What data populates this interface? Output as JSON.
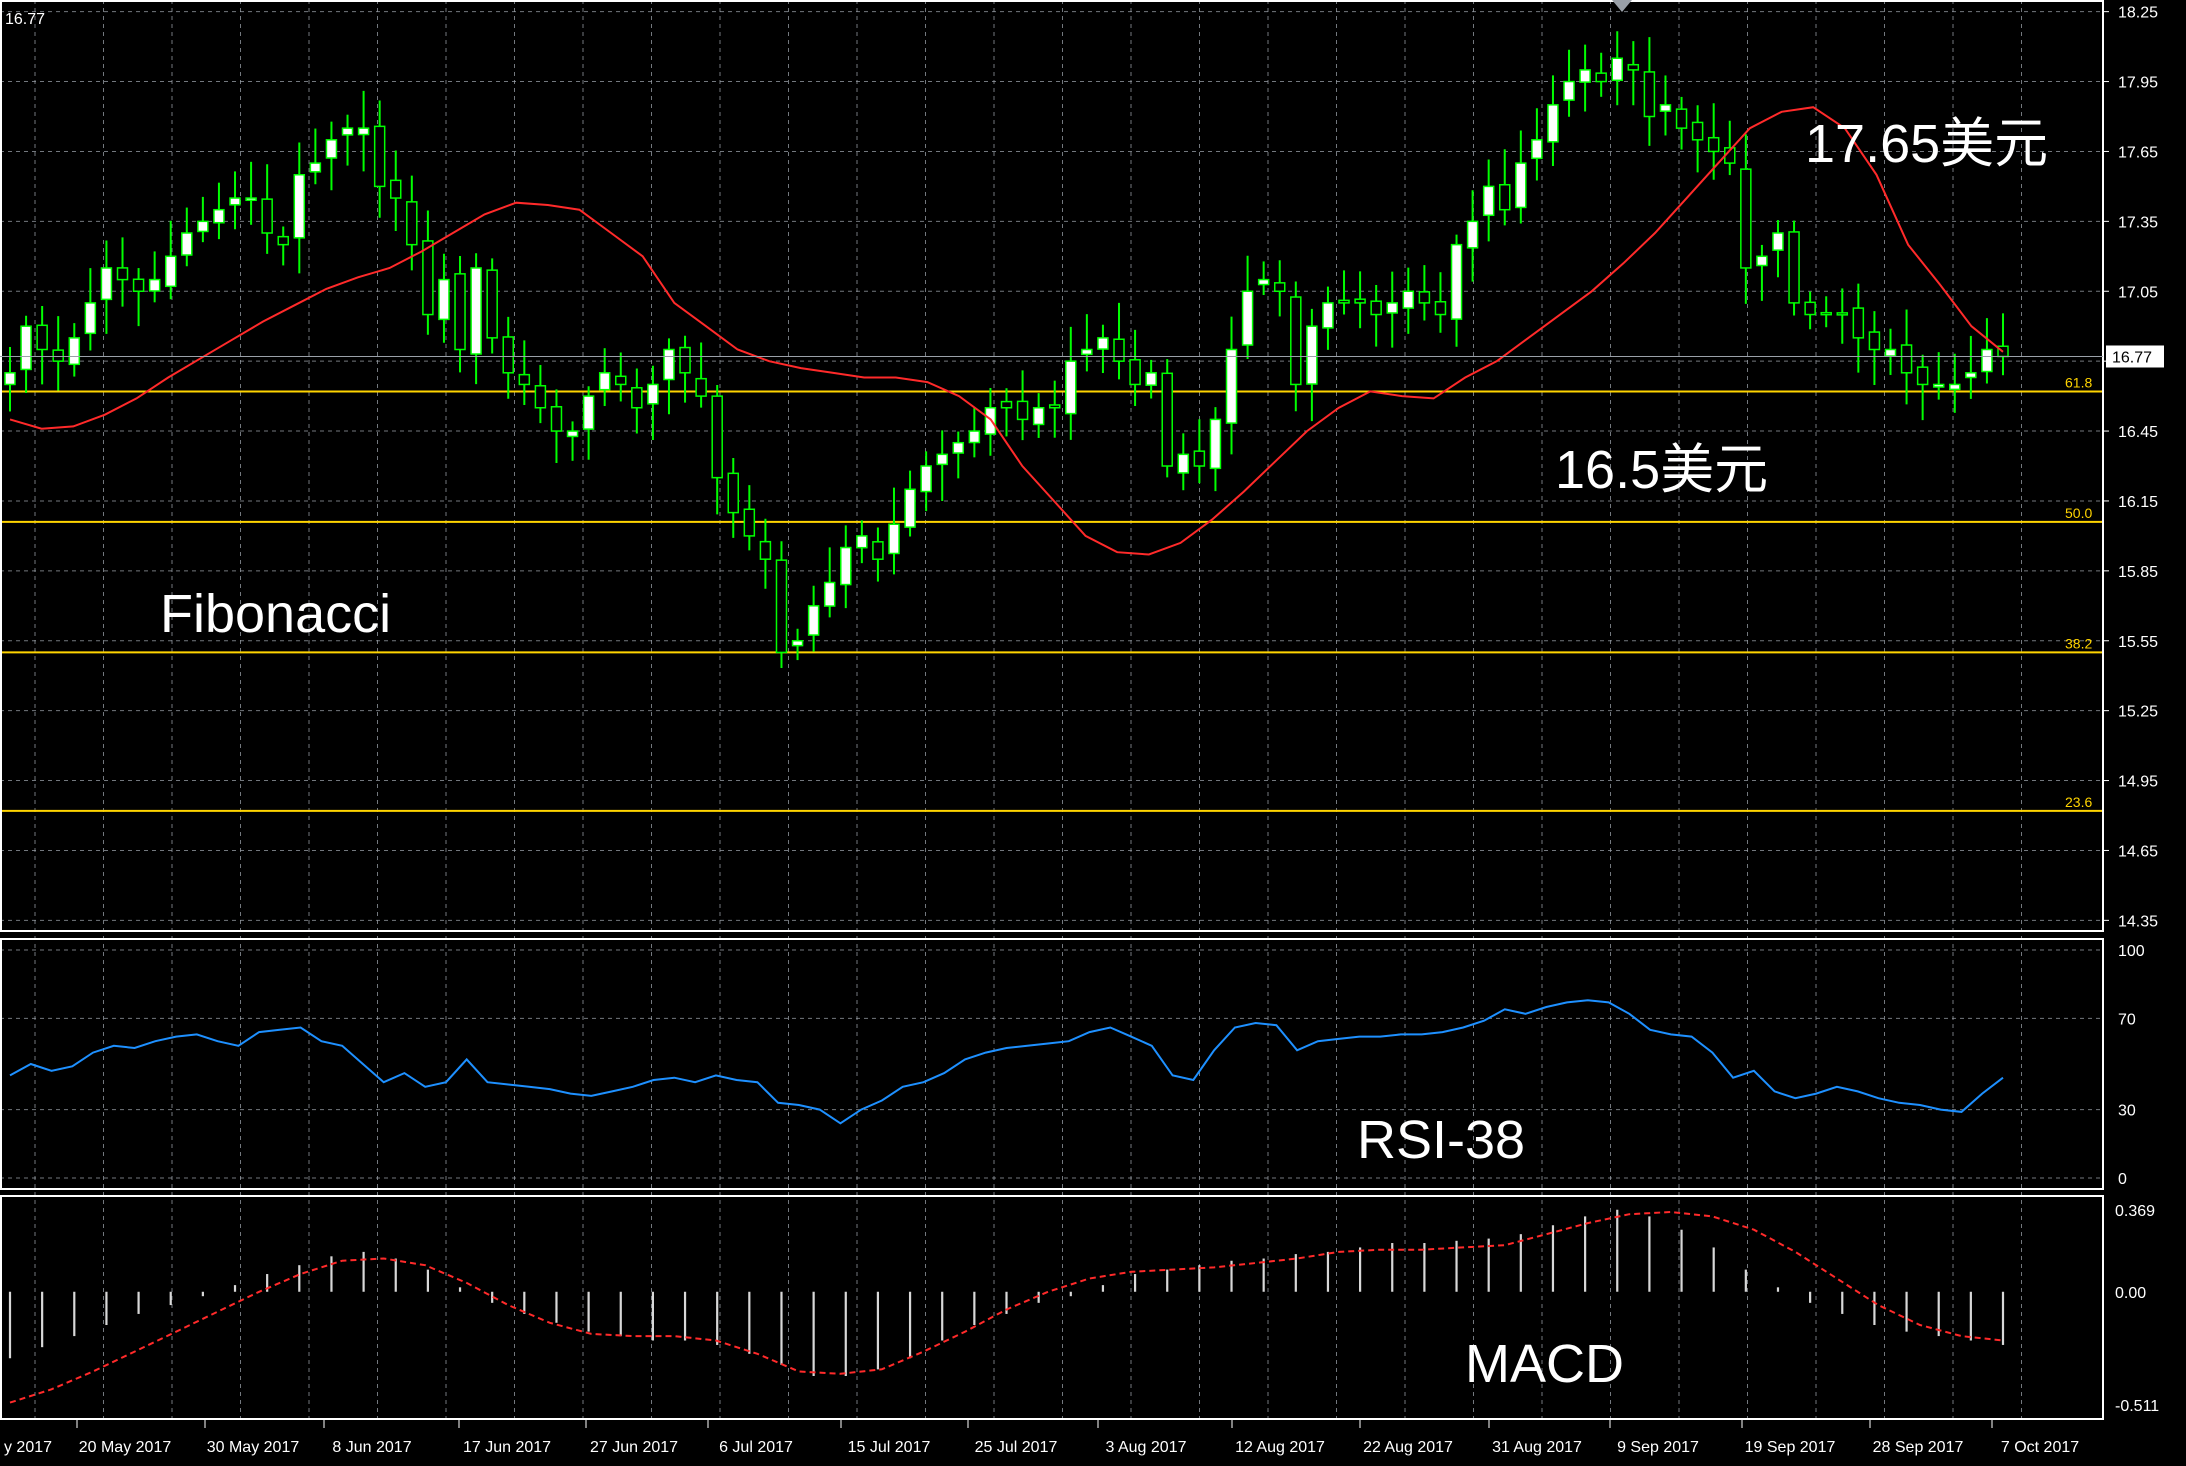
{
  "chart_data": {
    "type": "candlestick",
    "symbol_price_readout": "16.77",
    "colors": {
      "background": "#000000",
      "grid": "#9aa0a8",
      "bull_body": "#ffffff",
      "bear_body": "#000000",
      "wick": "#00ff00",
      "moving_average": "#ff2a2a",
      "fibonacci": "#ffd400",
      "rsi": "#1e90ff",
      "macd_histogram": "#d8d8d8",
      "macd_signal": "#ff2a2a"
    },
    "price_axis": {
      "ticks": [
        "18.25",
        "17.95",
        "17.65",
        "17.35",
        "17.05",
        "16.75",
        "16.45",
        "16.15",
        "15.85",
        "15.55",
        "15.25",
        "14.95",
        "14.65",
        "14.35"
      ],
      "ylim": [
        14.3,
        18.3
      ],
      "current_price": "16.77"
    },
    "fibonacci_levels": [
      {
        "label": "61.8",
        "price": 16.62
      },
      {
        "label": "50.0",
        "price": 16.06
      },
      {
        "label": "38.2",
        "price": 15.5
      },
      {
        "label": "23.6",
        "price": 14.82
      }
    ],
    "x_axis_labels": [
      "y 2017",
      "20 May 2017",
      "30 May 2017",
      "8 Jun 2017",
      "17 Jun 2017",
      "27 Jun 2017",
      "6 Jul 2017",
      "15 Jul 2017",
      "25 Jul 2017",
      "3 Aug 2017",
      "12 Aug 2017",
      "22 Aug 2017",
      "31 Aug 2017",
      "9 Sep 2017",
      "19 Sep 2017",
      "28 Sep 2017",
      "7 Oct 2017"
    ],
    "close_series": [
      16.7,
      16.9,
      16.8,
      16.75,
      16.85,
      17.0,
      17.15,
      17.1,
      17.05,
      17.1,
      17.2,
      17.3,
      17.35,
      17.4,
      17.45,
      17.45,
      17.3,
      17.25,
      17.55,
      17.6,
      17.7,
      17.75,
      17.75,
      17.5,
      17.45,
      17.25,
      16.95,
      17.1,
      16.8,
      17.15,
      16.85,
      16.7,
      16.65,
      16.55,
      16.45,
      16.45,
      16.6,
      16.7,
      16.65,
      16.55,
      16.65,
      16.8,
      16.7,
      16.6,
      16.25,
      16.1,
      16.0,
      15.9,
      15.5,
      15.55,
      15.7,
      15.8,
      15.95,
      16.0,
      15.9,
      16.05,
      16.2,
      16.3,
      16.35,
      16.4,
      16.45,
      16.55,
      16.55,
      16.5,
      16.55,
      16.55,
      16.75,
      16.8,
      16.85,
      16.75,
      16.65,
      16.7,
      16.3,
      16.35,
      16.3,
      16.5,
      16.8,
      17.05,
      17.1,
      17.05,
      16.65,
      16.9,
      17.0,
      17.0,
      17.0,
      16.95,
      17.0,
      17.05,
      17.0,
      16.95,
      17.25,
      17.35,
      17.5,
      17.4,
      17.6,
      17.7,
      17.85,
      17.95,
      18.0,
      17.95,
      18.05,
      18.0,
      17.8,
      17.85,
      17.75,
      17.7,
      17.65,
      17.6,
      17.15,
      17.2,
      17.3,
      17.0,
      16.95,
      16.95,
      16.95,
      16.85,
      16.8,
      16.8,
      16.7,
      16.65,
      16.65,
      16.65,
      16.7,
      16.8,
      16.77
    ],
    "moving_average_series": [
      16.5,
      16.46,
      16.47,
      16.52,
      16.59,
      16.68,
      16.76,
      16.84,
      16.92,
      16.99,
      17.06,
      17.11,
      17.15,
      17.22,
      17.3,
      17.38,
      17.43,
      17.42,
      17.4,
      17.3,
      17.2,
      17.0,
      16.9,
      16.8,
      16.75,
      16.72,
      16.7,
      16.68,
      16.68,
      16.66,
      16.6,
      16.5,
      16.3,
      16.15,
      16.0,
      15.93,
      15.92,
      15.97,
      16.07,
      16.19,
      16.32,
      16.45,
      16.55,
      16.62,
      16.6,
      16.59,
      16.68,
      16.75,
      16.85,
      16.95,
      17.05,
      17.17,
      17.3,
      17.45,
      17.6,
      17.75,
      17.82,
      17.84,
      17.75,
      17.55,
      17.25,
      17.08,
      16.9,
      16.79
    ],
    "rsi": {
      "label": "RSI-38",
      "ticks": [
        "100",
        "70",
        "30",
        "0"
      ],
      "values": [
        45,
        50,
        47,
        49,
        55,
        58,
        57,
        60,
        62,
        63,
        60,
        58,
        64,
        65,
        66,
        60,
        58,
        50,
        42,
        46,
        40,
        42,
        52,
        42,
        41,
        40,
        39,
        37,
        36,
        38,
        40,
        43,
        44,
        42,
        45,
        43,
        42,
        33,
        32,
        30,
        24,
        30,
        34,
        40,
        42,
        46,
        52,
        55,
        57,
        58,
        59,
        60,
        64,
        66,
        62,
        58,
        45,
        43,
        56,
        66,
        68,
        67,
        56,
        60,
        61,
        62,
        62,
        63,
        63,
        64,
        66,
        69,
        74,
        72,
        75,
        77,
        78,
        77,
        72,
        65,
        63,
        62,
        55,
        44,
        47,
        38,
        35,
        37,
        40,
        38,
        35,
        33,
        32,
        30,
        29,
        37,
        44
      ]
    },
    "macd": {
      "label": "MACD",
      "ticks": [
        "0.369",
        "0.00",
        "-0.511"
      ],
      "histogram": [
        -0.3,
        -0.25,
        -0.2,
        -0.15,
        -0.1,
        -0.06,
        -0.02,
        0.03,
        0.08,
        0.12,
        0.16,
        0.18,
        0.15,
        0.1,
        0.02,
        -0.05,
        -0.1,
        -0.14,
        -0.18,
        -0.2,
        -0.22,
        -0.22,
        -0.24,
        -0.28,
        -0.33,
        -0.38,
        -0.38,
        -0.35,
        -0.3,
        -0.22,
        -0.15,
        -0.1,
        -0.05,
        -0.02,
        0.03,
        0.08,
        0.1,
        0.12,
        0.14,
        0.15,
        0.17,
        0.18,
        0.2,
        0.22,
        0.22,
        0.23,
        0.24,
        0.26,
        0.3,
        0.34,
        0.37,
        0.34,
        0.28,
        0.2,
        0.1,
        0.02,
        -0.05,
        -0.1,
        -0.15,
        -0.18,
        -0.2,
        -0.22,
        -0.24
      ],
      "signal": [
        -0.5,
        -0.44,
        -0.36,
        -0.27,
        -0.18,
        -0.09,
        0.0,
        0.08,
        0.14,
        0.15,
        0.12,
        0.04,
        -0.06,
        -0.14,
        -0.19,
        -0.2,
        -0.2,
        -0.22,
        -0.28,
        -0.36,
        -0.37,
        -0.35,
        -0.27,
        -0.18,
        -0.08,
        0.0,
        0.06,
        0.09,
        0.1,
        0.11,
        0.13,
        0.15,
        0.18,
        0.19,
        0.19,
        0.2,
        0.21,
        0.26,
        0.31,
        0.35,
        0.36,
        0.34,
        0.28,
        0.18,
        0.06,
        -0.06,
        -0.15,
        -0.2,
        -0.22
      ]
    },
    "annotations": [
      {
        "text": "17.65美元",
        "target": "resistance"
      },
      {
        "text": "16.5美元",
        "target": "support"
      },
      {
        "text": "Fibonacci",
        "target": "fib-levels"
      }
    ]
  }
}
